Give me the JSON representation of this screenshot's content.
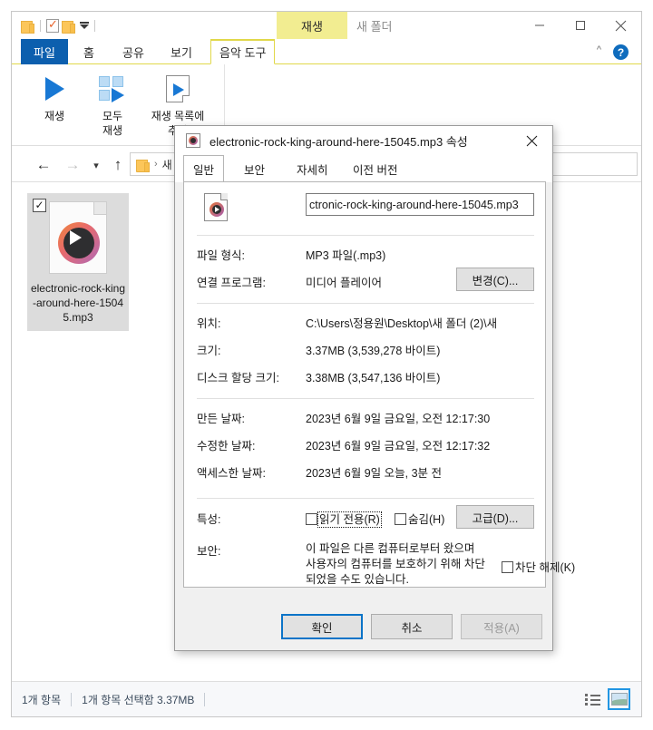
{
  "explorer": {
    "window_title": "새 폴더",
    "contextual_tab_header": "재생",
    "quick_access": {
      "folder_icon": "folder-icon",
      "properties_icon": "properties-checkmark-icon",
      "new_folder_icon": "new-folder-icon",
      "customize_icon": "chevron-down-icon"
    },
    "caption": {
      "minimize": "minimize-icon",
      "maximize": "maximize-icon",
      "close": "close-icon"
    },
    "tabs": [
      {
        "label": "파일",
        "active": false
      },
      {
        "label": "홈",
        "active": false
      },
      {
        "label": "공유",
        "active": false
      },
      {
        "label": "보기",
        "active": false
      },
      {
        "label": "음악 도구",
        "active": true
      }
    ],
    "ribbon_collapse_icon": "chevron-up-icon",
    "help_label": "?",
    "ribbon_items": [
      {
        "label": "재생",
        "icon": "play-icon"
      },
      {
        "label": "모두\n재생",
        "label_line1": "모두",
        "label_line2": "재생",
        "icon": "play-all-icon"
      },
      {
        "label": "재생 목록에 추가",
        "label_line1": "재생 목록에",
        "label_line2": "추가",
        "icon": "add-to-playlist-icon"
      }
    ],
    "nav": {
      "back_icon": "back-arrow-icon",
      "forward_icon": "forward-arrow-icon",
      "recent_icon": "recent-locations-icon",
      "up_icon": "up-arrow-icon"
    },
    "breadcrumb": {
      "folder_icon": "folder-icon",
      "separator": "›",
      "text": "새 ..."
    },
    "file_item": {
      "name": "electronic-rock-king-around-here-15045.mp3",
      "checked": true,
      "thumb_icon": "media-file-icon"
    },
    "status": {
      "item_count": "1개 항목",
      "selection": "1개 항목 선택함 3.37MB"
    },
    "view_buttons": [
      {
        "name": "details-view",
        "selected": false
      },
      {
        "name": "large-icons-view",
        "selected": true
      }
    ]
  },
  "dialog": {
    "title": "electronic-rock-king-around-here-15045.mp3 속성",
    "app_icon": "media-file-icon",
    "close_icon": "close-icon",
    "tabs": [
      {
        "label": "일반",
        "active": true
      },
      {
        "label": "보안",
        "active": false
      },
      {
        "label": "자세히",
        "active": false
      },
      {
        "label": "이전 버전",
        "active": false
      }
    ],
    "filename_value": "ctronic-rock-king-around-here-15045.mp3",
    "fields": [
      {
        "label": "파일 형식:",
        "value": "MP3 파일(.mp3)"
      },
      {
        "label": "연결 프로그램:",
        "value": "미디어 플레이어"
      },
      {
        "label": "위치:",
        "value": "C:\\Users\\정용원\\Desktop\\새 폴더 (2)\\새 "
      },
      {
        "label": "크기:",
        "value": "3.37MB (3,539,278 바이트)"
      },
      {
        "label": "디스크 할당 크기:",
        "value": "3.38MB (3,547,136 바이트)"
      },
      {
        "label": "만든 날짜:",
        "value": "2023년 6월 9일 금요일, 오전 12:17:30"
      },
      {
        "label": "수정한 날짜:",
        "value": "2023년 6월 9일 금요일, 오전 12:17:32"
      },
      {
        "label": "액세스한 날짜:",
        "value": "2023년 6월 9일 오늘, 3분 전"
      }
    ],
    "change_button": "변경(C)...",
    "advanced_button": "고급(D)...",
    "attributes_label": "특성:",
    "readonly_label": "읽기 전용(R)",
    "hidden_label": "숨김(H)",
    "security_label": "보안:",
    "security_text_line1": "이 파일은 다른 컴퓨터로부터 왔으며",
    "security_text_line2": "사용자의 컴퓨터를 보호하기 위해 차단",
    "security_text_line3": "되었을 수도 있습니다.",
    "unblock_label": "차단 해제(K)",
    "buttons": {
      "ok": "확인",
      "cancel": "취소",
      "apply": "적용(A)"
    }
  }
}
